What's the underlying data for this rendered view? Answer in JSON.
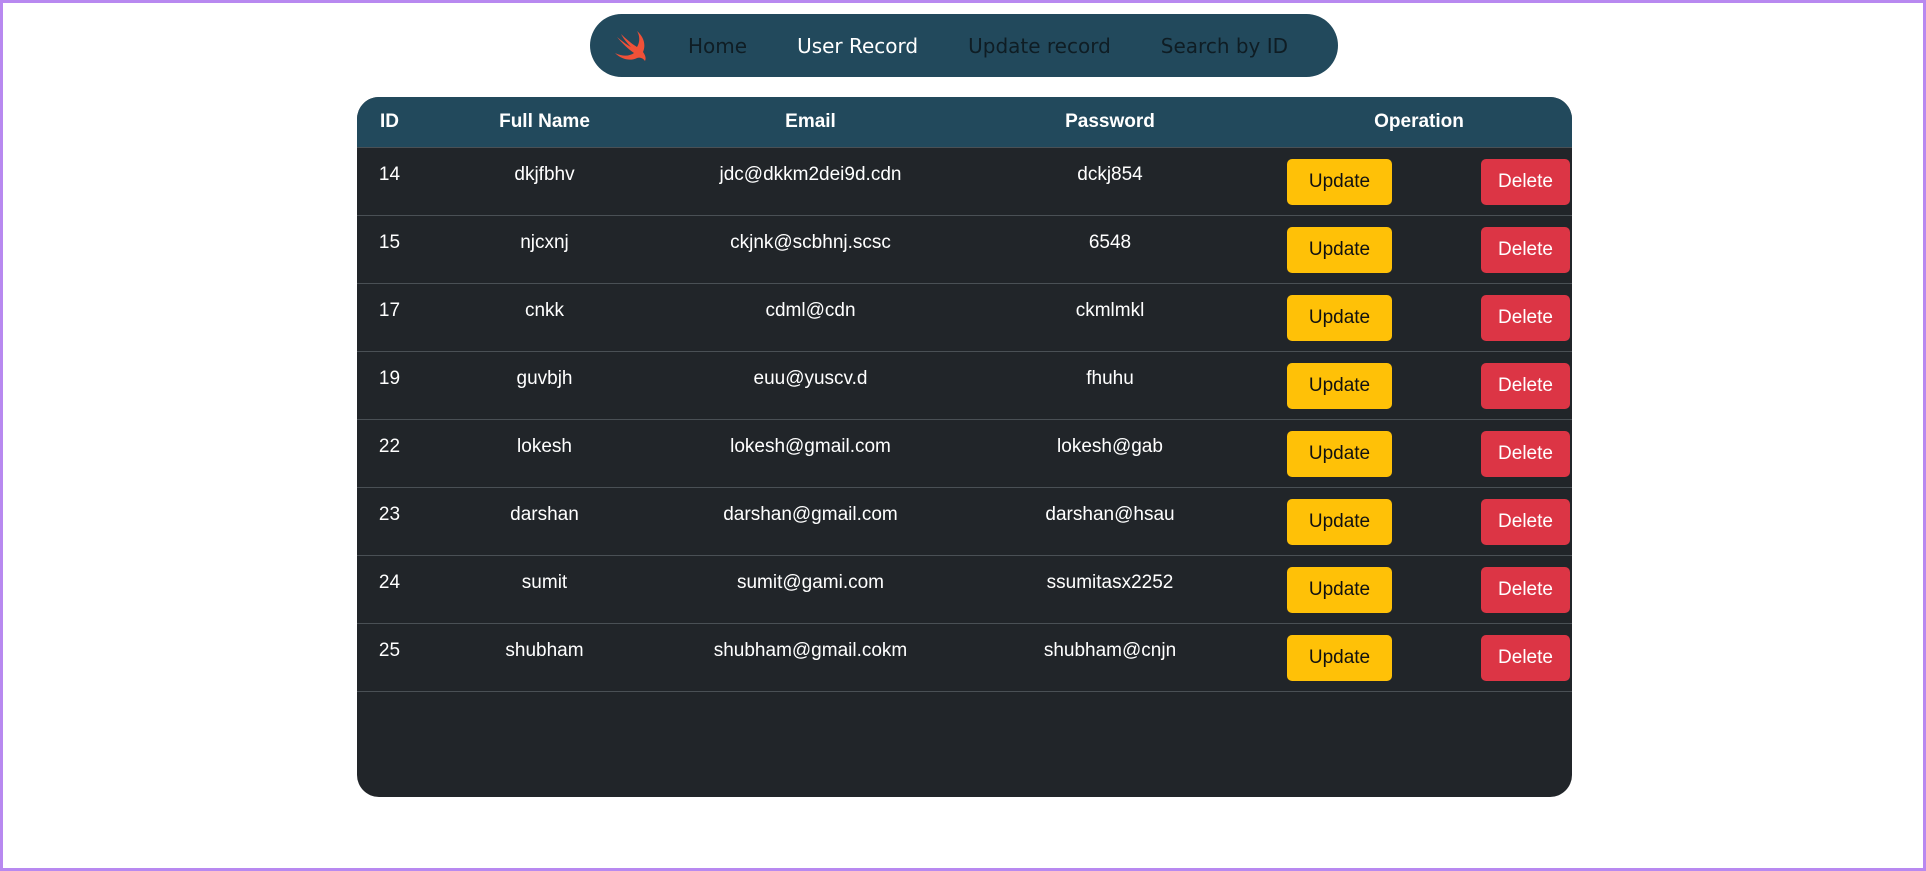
{
  "nav": {
    "logo_icon": "swift-icon",
    "links": [
      {
        "label": "Home",
        "active": false
      },
      {
        "label": "User Record",
        "active": true
      },
      {
        "label": "Update record",
        "active": false
      },
      {
        "label": "Search by ID",
        "active": false
      }
    ]
  },
  "table": {
    "headers": [
      "ID",
      "Full Name",
      "Email",
      "Password",
      "Operation"
    ],
    "update_label": "Update",
    "delete_label": "Delete",
    "rows": [
      {
        "id": "14",
        "name": "dkjfbhv",
        "email": "jdc@dkkm2dei9d.cdn",
        "password": "dckj854"
      },
      {
        "id": "15",
        "name": "njcxnj",
        "email": "ckjnk@scbhnj.scsc",
        "password": "6548"
      },
      {
        "id": "17",
        "name": "cnkk",
        "email": "cdml@cdn",
        "password": "ckmlmkl"
      },
      {
        "id": "19",
        "name": "guvbjh",
        "email": "euu@yuscv.d",
        "password": "fhuhu"
      },
      {
        "id": "22",
        "name": "lokesh",
        "email": "lokesh@gmail.com",
        "password": "lokesh@gab"
      },
      {
        "id": "23",
        "name": "darshan",
        "email": "darshan@gmail.com",
        "password": "darshan@hsau"
      },
      {
        "id": "24",
        "name": "sumit",
        "email": "sumit@gami.com",
        "password": "ssumitasx2252"
      },
      {
        "id": "25",
        "name": "shubham",
        "email": "shubham@gmail.cokm",
        "password": "shubham@cnjn"
      }
    ]
  },
  "colors": {
    "nav_bg": "#22495c",
    "table_bg": "#212529",
    "update_btn": "#ffc107",
    "delete_btn": "#dc3545",
    "frame": "#b889f0"
  }
}
